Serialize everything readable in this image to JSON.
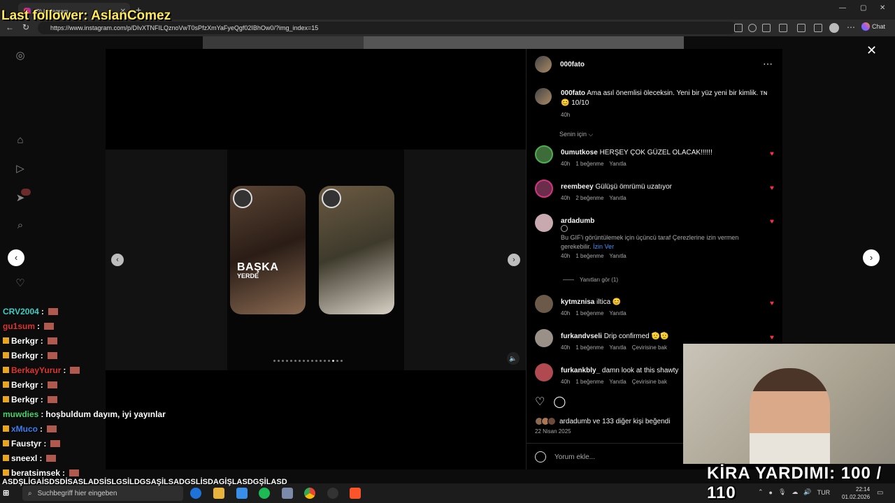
{
  "overlay": {
    "last_follower": "Last follower: AslanComez",
    "kira": "KİRA YARDIMI: 100 / 110"
  },
  "browser": {
    "tab_title": "(9) Instagram",
    "url": "https://www.instagram.com/p/DIvXTNFILQznoVwT0sPfzXmYaFyeQgf02IBhOw0/?img_index=15",
    "chat_label": "Chat"
  },
  "post": {
    "username": "000fato",
    "caption_user": "000fato",
    "caption_text": "Ama asıl önemlisi öleceksin. Yeni bir yüz yeni bir kimlik. ᴛɴ😊 10/10",
    "caption_time": "40h",
    "for_you": "Senin için ⌵",
    "card_title": "BAŞKA",
    "card_sub": "YERDE",
    "likes_text": "ardadumb ve 133 diğer kişi beğendi",
    "date": "22 Nisan 2025",
    "comment_placeholder": "Yorum ekle..."
  },
  "comments": [
    {
      "user": "0umutkose",
      "text": "HERŞEY ÇOK GÜZEL OLACAK!!!!!!",
      "time": "40h",
      "likes": "1 beğenme",
      "reply": "Yanıtla",
      "translate": ""
    },
    {
      "user": "reembeey",
      "text": "Gülüşü ömrümü uzatıyor",
      "time": "40h",
      "likes": "2 beğenme",
      "reply": "Yanıtla",
      "translate": ""
    },
    {
      "user": "ardadumb",
      "text": "",
      "time": "40h",
      "likes": "1 beğenme",
      "reply": "Yanıtla",
      "translate": ""
    },
    {
      "user": "kytmznisa",
      "text": "iltica 😊",
      "time": "40h",
      "likes": "1 beğenme",
      "reply": "Yanıtla",
      "translate": ""
    },
    {
      "user": "furkandvseli",
      "text": "Drip confirmed 🫡🫡",
      "time": "40h",
      "likes": "1 beğenme",
      "reply": "Yanıtla",
      "translate": "Çevirisine bak"
    },
    {
      "user": "furkankbly_",
      "text": "damn look at this shawty",
      "time": "40h",
      "likes": "1 beğenme",
      "reply": "Yanıtla",
      "translate": "Çevirisine bak"
    }
  ],
  "gif_note": "Bu GIF'i görüntülemek için üçüncü taraf Çerezlerine izin vermen gerekebilir.",
  "gif_link": "İzin Ver",
  "view_replies": "Yanıtları gör (1)",
  "chat": [
    {
      "user": "CRV2004",
      "color": "#3ad1c7",
      "msg": ""
    },
    {
      "user": "gu1sum",
      "color": "#e0342f",
      "msg": ""
    },
    {
      "user": "Berkgr",
      "color": "#ffffff",
      "msg": ""
    },
    {
      "user": "Berkgr",
      "color": "#ffffff",
      "msg": ""
    },
    {
      "user": "BerkayYurur",
      "color": "#e0342f",
      "msg": ""
    },
    {
      "user": "Berkgr",
      "color": "#ffffff",
      "msg": ""
    },
    {
      "user": "Berkgr",
      "color": "#ffffff",
      "msg": ""
    },
    {
      "user": "muwdies",
      "color": "#45d66a",
      "msg": "hoşbuldum dayım, iyi yayınlar"
    },
    {
      "user": "xMuco",
      "color": "#3a7ff0",
      "msg": ""
    },
    {
      "user": "Faustyr",
      "color": "#ffffff",
      "msg": ""
    },
    {
      "user": "sneexl",
      "color": "#ffffff",
      "msg": ""
    },
    {
      "user": "beratsimsek",
      "color": "#ffffff",
      "msg": ""
    }
  ],
  "chat_spam": "ASDŞLİGAİSDSDİSASLADSİSLGSİLDGSAŞİLSADGSLİSDAGİŞLASDGŞİLASD",
  "taskbar": {
    "search_placeholder": "Suchbegriff hier eingeben",
    "lang": "TUR",
    "time": "22:14",
    "date": "01.02.2026"
  }
}
